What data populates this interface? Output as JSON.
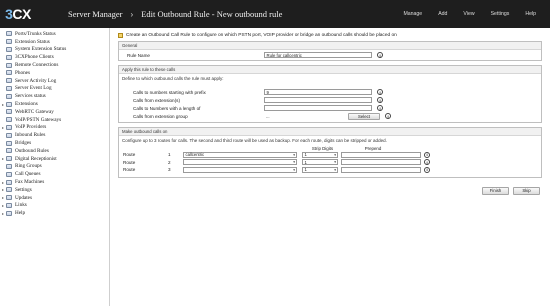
{
  "header": {
    "logo_three": "3",
    "logo_cx": "CX",
    "app_title": "Server Manager",
    "chevron": "›",
    "page_title": "Edit Outbound Rule - New outbound rule",
    "nav": [
      "Manage",
      "Add",
      "View",
      "Settings",
      "Help"
    ]
  },
  "sidebar": {
    "items": [
      {
        "label": "Ports/Trunks Status",
        "arrow": ""
      },
      {
        "label": "Extension Status",
        "arrow": ""
      },
      {
        "label": "System Extension Status",
        "arrow": ""
      },
      {
        "label": "3CXPhone Clients",
        "arrow": ""
      },
      {
        "label": "Remote Connections",
        "arrow": ""
      },
      {
        "label": "Phones",
        "arrow": ""
      },
      {
        "label": "Server Activity Log",
        "arrow": ""
      },
      {
        "label": "Server Event Log",
        "arrow": ""
      },
      {
        "label": "Services status",
        "arrow": ""
      },
      {
        "label": "Extensions",
        "arrow": "▸"
      },
      {
        "label": "WebRTC Gateway",
        "arrow": ""
      },
      {
        "label": "VoIP/PSTN Gateways",
        "arrow": ""
      },
      {
        "label": "VoIP Providers",
        "arrow": "▸"
      },
      {
        "label": "Inbound Rules",
        "arrow": ""
      },
      {
        "label": "Bridges",
        "arrow": ""
      },
      {
        "label": "Outbound Rules",
        "arrow": ""
      },
      {
        "label": "Digital Receptionist",
        "arrow": "▸"
      },
      {
        "label": "Ring Groups",
        "arrow": ""
      },
      {
        "label": "Call Queues",
        "arrow": ""
      },
      {
        "label": "Fax Machines",
        "arrow": "▸"
      },
      {
        "label": "Settings",
        "arrow": "▸"
      },
      {
        "label": "Updates",
        "arrow": "▸"
      },
      {
        "label": "Links",
        "arrow": "▸"
      },
      {
        "label": "Help",
        "arrow": "▸"
      }
    ]
  },
  "main": {
    "intro": "Create an Outbound Call Rule to configure on which PSTN port, VOIP provider or bridge an outbound calls should be placed on",
    "general": {
      "heading": "General",
      "rule_name_label": "Rule Name",
      "rule_name_value": "Rule for callcentric"
    },
    "apply": {
      "heading": "Apply this rule to these calls",
      "desc": "Define to which outbound calls the rule must apply:",
      "prefix_label": "Calls to numbers starting with prefix",
      "prefix_value": "9",
      "ext_label": "Calls from extension(s)",
      "ext_value": "",
      "length_label": "Calls to Numbers with a length of",
      "length_value": "",
      "group_label": "Calls from extension group",
      "group_value": "...",
      "select_label": "Select"
    },
    "make": {
      "heading": "Make outbound calls on",
      "desc": "Configure up to 3 routes for calls. The second and third route will be used as backup. For each route, digits can be stripped or added.",
      "strip_header": "Strip Digits",
      "prepend_header": "Prepend",
      "routes": [
        {
          "label": "Route",
          "num": "1",
          "provider": "callcentric",
          "strip": "1"
        },
        {
          "label": "Route",
          "num": "2",
          "provider": "",
          "strip": "1"
        },
        {
          "label": "Route",
          "num": "3",
          "provider": "",
          "strip": "1"
        }
      ]
    },
    "finish_label": "Finish",
    "skip_label": "Skip"
  }
}
